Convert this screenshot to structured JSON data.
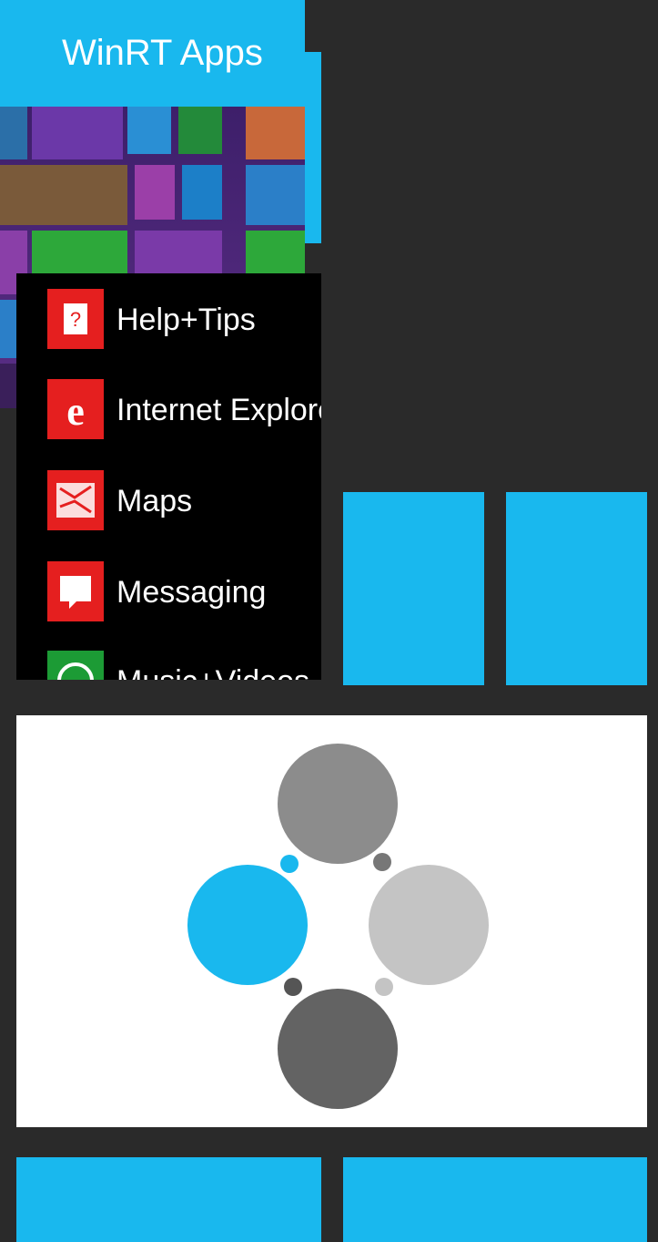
{
  "tiles": {
    "winrt_title": "WinRT Apps"
  },
  "app_list": {
    "items": [
      {
        "label": "Help+Tips",
        "icon": "help-icon"
      },
      {
        "label": "Internet Explorer",
        "icon": "internet-explorer-icon"
      },
      {
        "label": "Maps",
        "icon": "maps-icon"
      },
      {
        "label": "Messaging",
        "icon": "messaging-icon"
      },
      {
        "label": "Music+Videos",
        "icon": "music-videos-icon"
      }
    ]
  },
  "colors": {
    "accent": "#19b8ee",
    "background": "#2a2a2a",
    "app_icon_red": "#e51f1f",
    "app_icon_green": "#1c9b35"
  }
}
